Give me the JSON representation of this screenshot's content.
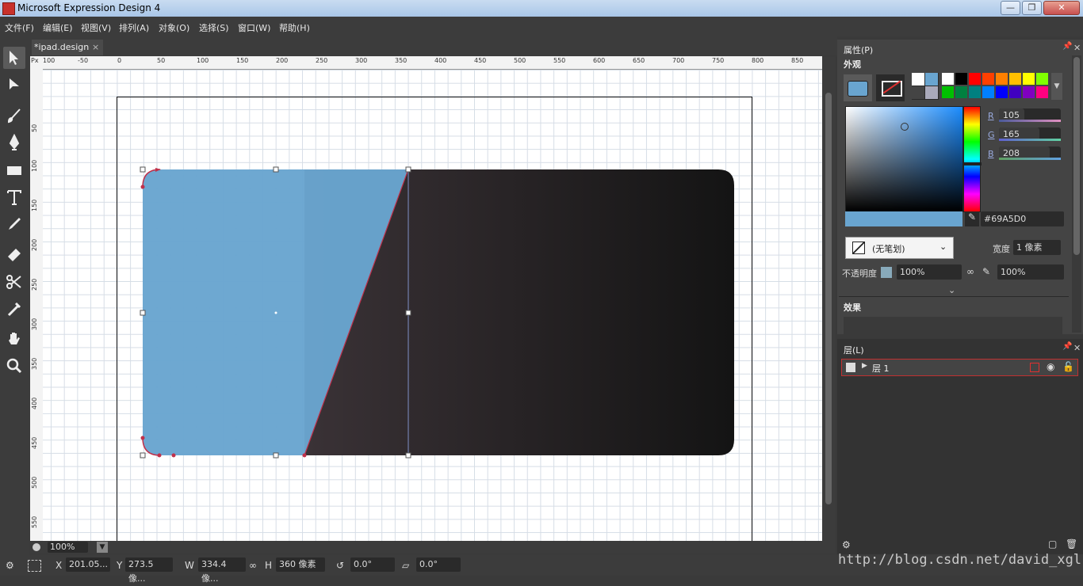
{
  "window": {
    "title": "Microsoft Expression Design 4",
    "min": "—",
    "max": "❐",
    "close": "✕"
  },
  "menu": [
    "文件(F)",
    "编辑(E)",
    "视图(V)",
    "排列(A)",
    "对象(O)",
    "选择(S)",
    "窗口(W)",
    "帮助(H)"
  ],
  "tools": [
    "selection-icon",
    "direct-selection-icon",
    "brush-icon",
    "pen-icon",
    "rectangle-icon",
    "text-icon",
    "eyedropper-icon",
    "eraser-icon",
    "scissors-icon",
    "color-picker-icon",
    "hand-icon",
    "zoom-icon"
  ],
  "document": {
    "tab_label": "*ipad.design",
    "tab_close": "×"
  },
  "ruler": {
    "unit": "Px",
    "top_ticks": [
      "100",
      "-50",
      "0",
      "50",
      "100",
      "150",
      "200",
      "250",
      "300",
      "350",
      "400",
      "450",
      "500",
      "550",
      "600",
      "650",
      "700",
      "750",
      "800",
      "850"
    ],
    "left_ticks": [
      "50",
      "100",
      "150",
      "200",
      "250",
      "300",
      "350",
      "400",
      "450",
      "500",
      "550"
    ]
  },
  "canvas": {
    "fill_color": "#69A5D0",
    "dark_gradient": [
      "#3a3236",
      "#141414"
    ],
    "selection_color": "#c0304a"
  },
  "properties": {
    "title": "属性(P)",
    "appearance_title": "外观",
    "swatches": [
      "#ffffff",
      "#000000",
      "#ff0000",
      "#ff4000",
      "#ff8000",
      "#ffc000",
      "#ffff00",
      "#80ff00",
      "#00c000",
      "#008040",
      "#008080",
      "#0080ff",
      "#0000ff",
      "#4000c0",
      "#8000c0",
      "#ff0080"
    ],
    "rgb": {
      "r_label": "R",
      "g_label": "G",
      "b_label": "B",
      "r": "105",
      "g": "165",
      "b": "208",
      "r_fill": 0.41,
      "g_fill": 0.65,
      "b_fill": 0.82
    },
    "hex": "#69A5D0",
    "stroke_select": "(无笔划)",
    "width_label": "宽度",
    "width_value": "1 像素",
    "opacity_label": "不透明度",
    "opacity_value": "100%",
    "opacity_value2": "100%",
    "effects_title": "效果"
  },
  "layers": {
    "title": "层(L)",
    "layer_name": "层 1"
  },
  "zoom": {
    "value": "100%"
  },
  "status": {
    "x_label": "X",
    "x_value": "201.05...",
    "y_label": "Y",
    "y_value": "273.5 像...",
    "w_label": "W",
    "w_value": "334.4 像...",
    "h_label": "H",
    "h_value": "360 像素",
    "rotate_value": "0.0°",
    "skew_value": "0.0°"
  },
  "watermark": "http://blog.csdn.net/david_xgl"
}
